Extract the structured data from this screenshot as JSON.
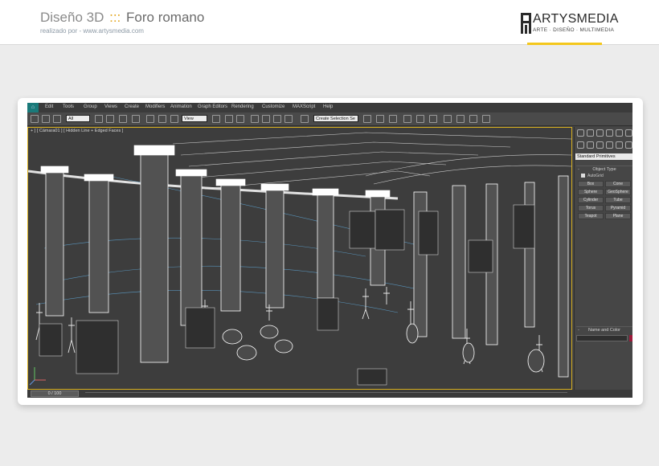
{
  "header": {
    "title_prefix": "Diseño 3D",
    "title_separator": ":::",
    "title_project": "Foro romano",
    "subtitle": "realizado por - www.artysmedia.com",
    "logo_name": "ARTYSMEDIA",
    "logo_tagline": "ARTE · DISEÑO · MULTIMEDIA"
  },
  "colors": {
    "accent_yellow": "#f4c71c",
    "separator_orange": "#e2a41a",
    "viewport_border": "#d8b020",
    "wire_white": "#ffffff",
    "wire_blue": "#5fa8d8"
  },
  "app": {
    "menu": [
      "Edit",
      "Tools",
      "Group",
      "Views",
      "Create",
      "Modifiers",
      "Animation",
      "Graph Editors",
      "Rendering",
      "Customize",
      "MAXScript",
      "Help"
    ],
    "toolbar": {
      "filter_select": "All",
      "view_select": "View",
      "selection_set": "Create Selection Se"
    },
    "viewport_label": "+ ] [ Cámara01 ] [ Hidden Line + Edged Faces ]",
    "timeline": "0 / 100",
    "panel": {
      "dropdown": "Standard Primitives",
      "rollout_object_type": "Object Type",
      "autogrid_label": "AutoGrid",
      "buttons": [
        "Box",
        "Cone",
        "Sphere",
        "GeoSphere",
        "Cylinder",
        "Tube",
        "Torus",
        "Pyramid",
        "Teapot",
        "Plane"
      ],
      "rollout_name_color": "Name and Color",
      "rollout_sign": "-"
    }
  }
}
